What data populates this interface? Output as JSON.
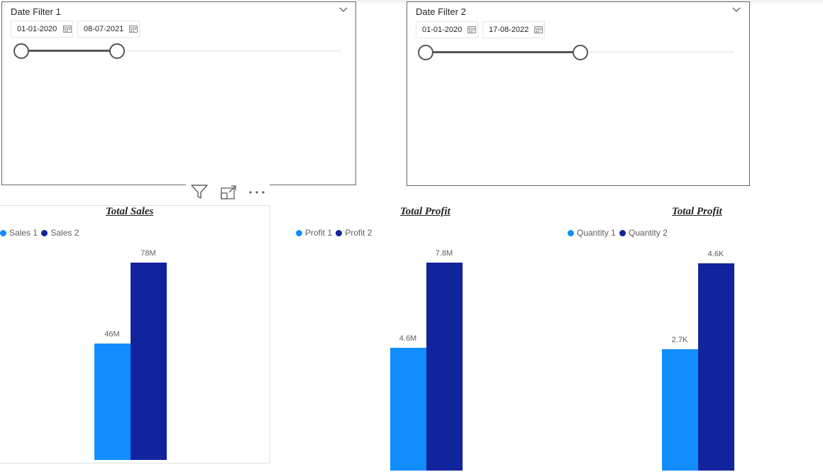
{
  "colors": {
    "series1": "#118DFF",
    "series2": "#12239E",
    "slider": "#555555",
    "border": "#666666"
  },
  "slicers": [
    {
      "title": "Date Filter 1",
      "start": "01-01-2020",
      "end": "08-07-2021",
      "range_fraction": [
        0.0,
        0.3
      ],
      "expand_icon": "chevron-down-icon",
      "date_icon": "calendar-icon"
    },
    {
      "title": "Date Filter 2",
      "start": "01-01-2020",
      "end": "17-08-2022",
      "range_fraction": [
        0.0,
        0.5
      ],
      "expand_icon": "chevron-down-icon",
      "date_icon": "calendar-icon"
    }
  ],
  "visual_header": {
    "icons": [
      "filter-icon",
      "focus-mode-icon",
      "more-options-icon"
    ]
  },
  "chart_data": [
    {
      "type": "bar",
      "title": "Total Sales",
      "categories": [
        ""
      ],
      "series": [
        {
          "name": "Sales 1",
          "values": [
            46000000
          ],
          "label": "46M"
        },
        {
          "name": "Sales 2",
          "values": [
            78000000
          ],
          "label": "78M"
        }
      ],
      "ylim": [
        0,
        78000000
      ],
      "legend": "top-left",
      "grid": false
    },
    {
      "type": "bar",
      "title": "Total Profit",
      "categories": [
        ""
      ],
      "series": [
        {
          "name": "Profit 1",
          "values": [
            4600000
          ],
          "label": "4.6M"
        },
        {
          "name": "Profit 2",
          "values": [
            7800000
          ],
          "label": "7.8M"
        }
      ],
      "ylim": [
        0,
        7800000
      ],
      "legend": "top-left",
      "grid": false
    },
    {
      "type": "bar",
      "title": "Total Profit",
      "categories": [
        ""
      ],
      "series": [
        {
          "name": "Quantity 1",
          "values": [
            2700
          ],
          "label": "2.7K"
        },
        {
          "name": "Quantity 2",
          "values": [
            4600
          ],
          "label": "4.6K"
        }
      ],
      "ylim": [
        0,
        4600
      ],
      "legend": "top-left",
      "grid": false
    }
  ]
}
